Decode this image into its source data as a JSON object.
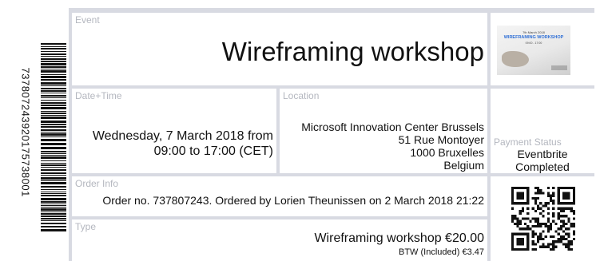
{
  "barcode": {
    "number": "737807243920175738001"
  },
  "event": {
    "label": "Event",
    "title": "Wireframing workshop"
  },
  "thumbnail": {
    "date": "7th March 2018",
    "title": "WIREFRAMING WORKSHOP",
    "sub": "09:00 - 17:00"
  },
  "datetime": {
    "label": "Date+Time",
    "line1": "Wednesday, 7 March 2018 from",
    "line2": "09:00 to 17:00 (CET)"
  },
  "location": {
    "label": "Location",
    "lines": [
      "Microsoft Innovation Center Brussels",
      "51 Rue Montoyer",
      "1000 Bruxelles",
      "Belgium"
    ]
  },
  "payment": {
    "label": "Payment Status",
    "line1": "Eventbrite",
    "line2": "Completed"
  },
  "order": {
    "label": "Order Info",
    "text": "Order no. 737807243. Ordered by Lorien Theunissen on 2 March 2018 21:22"
  },
  "type": {
    "label": "Type",
    "text": "Wireframing workshop €20.00",
    "tax": "BTW (Included) €3.47"
  },
  "icons": {
    "barcode": "barcode-icon",
    "qr": "qr-code-icon"
  }
}
